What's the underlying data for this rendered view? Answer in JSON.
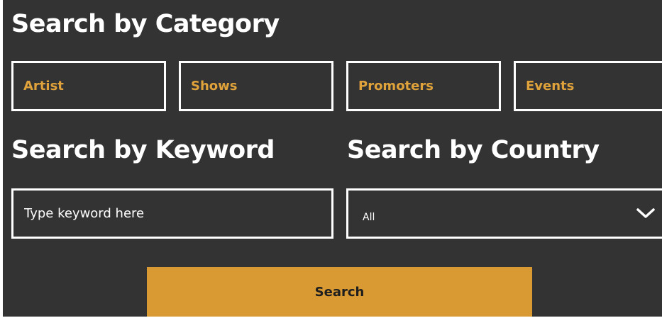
{
  "headings": {
    "category": "Search by Category",
    "keyword": "Search by Keyword",
    "country": "Search by Country"
  },
  "categories": [
    {
      "label": "Artist"
    },
    {
      "label": "Shows"
    },
    {
      "label": "Promoters"
    },
    {
      "label": "Events"
    }
  ],
  "keyword": {
    "value": "",
    "placeholder": "Type keyword here"
  },
  "country": {
    "selected": "All",
    "icon": "chevron-down-icon"
  },
  "search_button": {
    "label": "Search"
  },
  "colors": {
    "background": "#333333",
    "accent": "#d99a33",
    "category_text": "#e0a23a",
    "border": "#ffffff"
  }
}
